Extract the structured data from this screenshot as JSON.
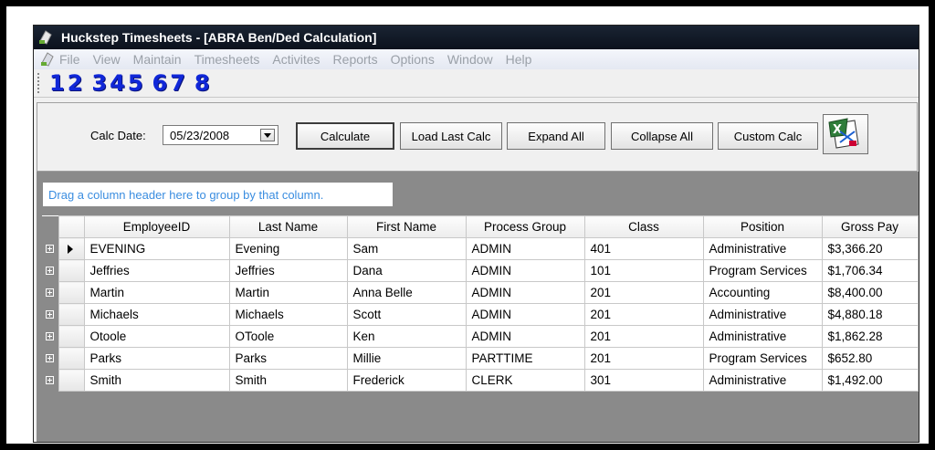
{
  "window": {
    "title": "Huckstep Timesheets - [ABRA Ben/Ded Calculation]"
  },
  "menu": [
    "File",
    "View",
    "Maintain",
    "Timesheets",
    "Activites",
    "Reports",
    "Options",
    "Window",
    "Help"
  ],
  "numbers": [
    "1",
    "2",
    "3",
    "4",
    "5",
    "6",
    "7",
    "8"
  ],
  "toolbar": {
    "calc_date_label": "Calc Date:",
    "calc_date_value": "05/23/2008",
    "calculate": "Calculate",
    "load_last_calc": "Load Last Calc",
    "expand_all": "Expand All",
    "collapse_all": "Collapse All",
    "custom_calc": "Custom Calc"
  },
  "grid": {
    "group_hint": "Drag a column header here to group by that column.",
    "columns": [
      "EmployeeID",
      "Last Name",
      "First Name",
      "Process Group",
      "Class",
      "Position",
      "Gross Pay"
    ],
    "rows": [
      [
        "EVENING",
        "Evening",
        "Sam",
        "ADMIN",
        "401",
        "Administrative",
        "$3,366.20"
      ],
      [
        "Jeffries",
        "Jeffries",
        "Dana",
        "ADMIN",
        "101",
        "Program Services",
        "$1,706.34"
      ],
      [
        "Martin",
        "Martin",
        "Anna Belle",
        "ADMIN",
        "201",
        "Accounting",
        "$8,400.00"
      ],
      [
        "Michaels",
        "Michaels",
        "Scott",
        "ADMIN",
        "201",
        "Administrative",
        "$4,880.18"
      ],
      [
        "Otoole",
        "OToole",
        "Ken",
        "ADMIN",
        "201",
        "Administrative",
        "$1,862.28"
      ],
      [
        "Parks",
        "Parks",
        "Millie",
        "PARTTIME",
        "201",
        "Program Services",
        "$652.80"
      ],
      [
        "Smith",
        "Smith",
        "Frederick",
        "CLERK",
        "301",
        "Administrative",
        "$1,492.00"
      ]
    ]
  },
  "colors": {
    "title_bg": "#0b111c",
    "number_blue": "#1027d8",
    "group_hint_text": "#3a8de0",
    "grid_bg": "#8a8a8a"
  }
}
